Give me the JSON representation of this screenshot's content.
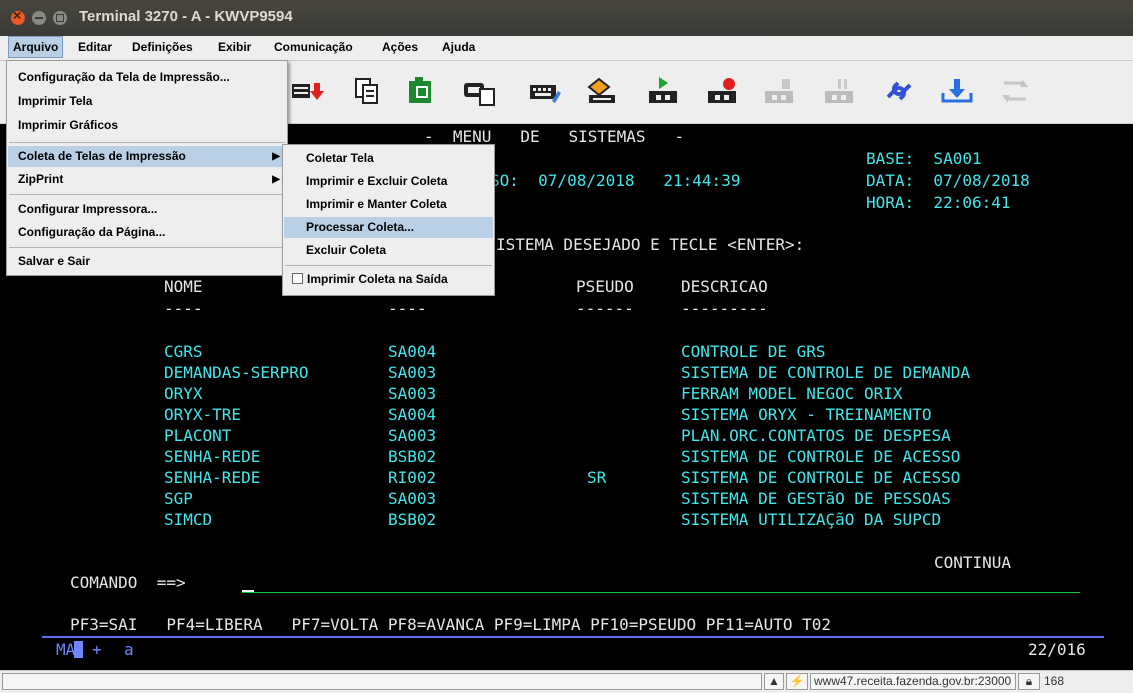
{
  "window": {
    "title": "Terminal 3270 - A - KWVP9594"
  },
  "menubar": [
    "Arquivo",
    "Editar",
    "Definições",
    "Exibir",
    "Comunicação",
    "Ações",
    "Ajuda"
  ],
  "arquivo_menu": {
    "items": [
      "Configuração da Tela de Impressão...",
      "Imprimir Tela",
      "Imprimir Gráficos",
      "Coleta de Telas de Impressão",
      "ZipPrint",
      "Configurar Impressora...",
      "Configuração da Página...",
      "Salvar e Sair"
    ]
  },
  "coleta_menu": {
    "items": [
      "Coletar Tela",
      "Imprimir e Excluir Coleta",
      "Imprimir e Manter Coleta",
      "Processar Coleta...",
      "Excluir Coleta",
      "Imprimir Coleta na Saída"
    ]
  },
  "toolbar_icons": [
    "download-red-arrow-icon",
    "copy-icon",
    "green-page-icon",
    "screen-copy-icon",
    "keyboard-icon",
    "paint-icon",
    "phone-green-icon",
    "phone-red-icon",
    "phone-disabled-icon",
    "phone-disabled-2-icon",
    "link-icon",
    "download-blue-icon",
    "refresh-disabled-icon"
  ],
  "terminal": {
    "header": "-  MENU   DE   SISTEMAS   -",
    "base": "BASE:  SA001",
    "data": "DATA:  07/08/2018",
    "access_fragment": "SO:  07/08/2018   21:44:39",
    "hora": "HORA:  22:06:41",
    "instruction_fragment": "ISTEMA DESEJADO E TECLE <ENTER>:",
    "columns": {
      "nome": "NOME",
      "pseudo": "PSEUDO",
      "descricao": "DESCRICAO"
    },
    "underlines": {
      "nome": "----",
      "sigla": "----",
      "pseudo": "------",
      "descricao": "---------"
    },
    "rows": [
      {
        "nome": "CGRS",
        "sigla": "SA004",
        "pseudo": "",
        "descricao": "CONTROLE DE GRS"
      },
      {
        "nome": "DEMANDAS-SERPRO",
        "sigla": "SA003",
        "pseudo": "",
        "descricao": "SISTEMA DE CONTROLE DE DEMANDA"
      },
      {
        "nome": "ORYX",
        "sigla": "SA003",
        "pseudo": "",
        "descricao": "FERRAM MODEL NEGOC ORIX"
      },
      {
        "nome": "ORYX-TRE",
        "sigla": "SA004",
        "pseudo": "",
        "descricao": "SISTEMA ORYX - TREINAMENTO"
      },
      {
        "nome": "PLACONT",
        "sigla": "SA003",
        "pseudo": "",
        "descricao": "PLAN.ORC.CONTATOS DE DESPESA"
      },
      {
        "nome": "SENHA-REDE",
        "sigla": "BSB02",
        "pseudo": "",
        "descricao": "SISTEMA DE CONTROLE DE ACESSO"
      },
      {
        "nome": "SENHA-REDE",
        "sigla": "RI002",
        "pseudo": "SR",
        "descricao": "SISTEMA DE CONTROLE DE ACESSO"
      },
      {
        "nome": "SGP",
        "sigla": "SA003",
        "pseudo": "",
        "descricao": "SISTEMA DE GESTãO DE PESSOAS"
      },
      {
        "nome": "SIMCD",
        "sigla": "BSB02",
        "pseudo": "",
        "descricao": "SISTEMA UTILIZAÇãO DA SUPCD"
      }
    ],
    "continua": "CONTINUA",
    "comando_label": "COMANDO  ==>",
    "pf_keys": "PF3=SAI   PF4=LIBERA   PF7=VOLTA PF8=AVANCA PF9=LIMPA PF10=PSEUDO PF11=AUTO T02",
    "oia_left": "MA",
    "oia_plus": "+",
    "oia_a": "a",
    "cursor_pos": "22/016"
  },
  "statusbar": {
    "host": "www47.receita.fazenda.gov.br:23000",
    "num": "168"
  }
}
